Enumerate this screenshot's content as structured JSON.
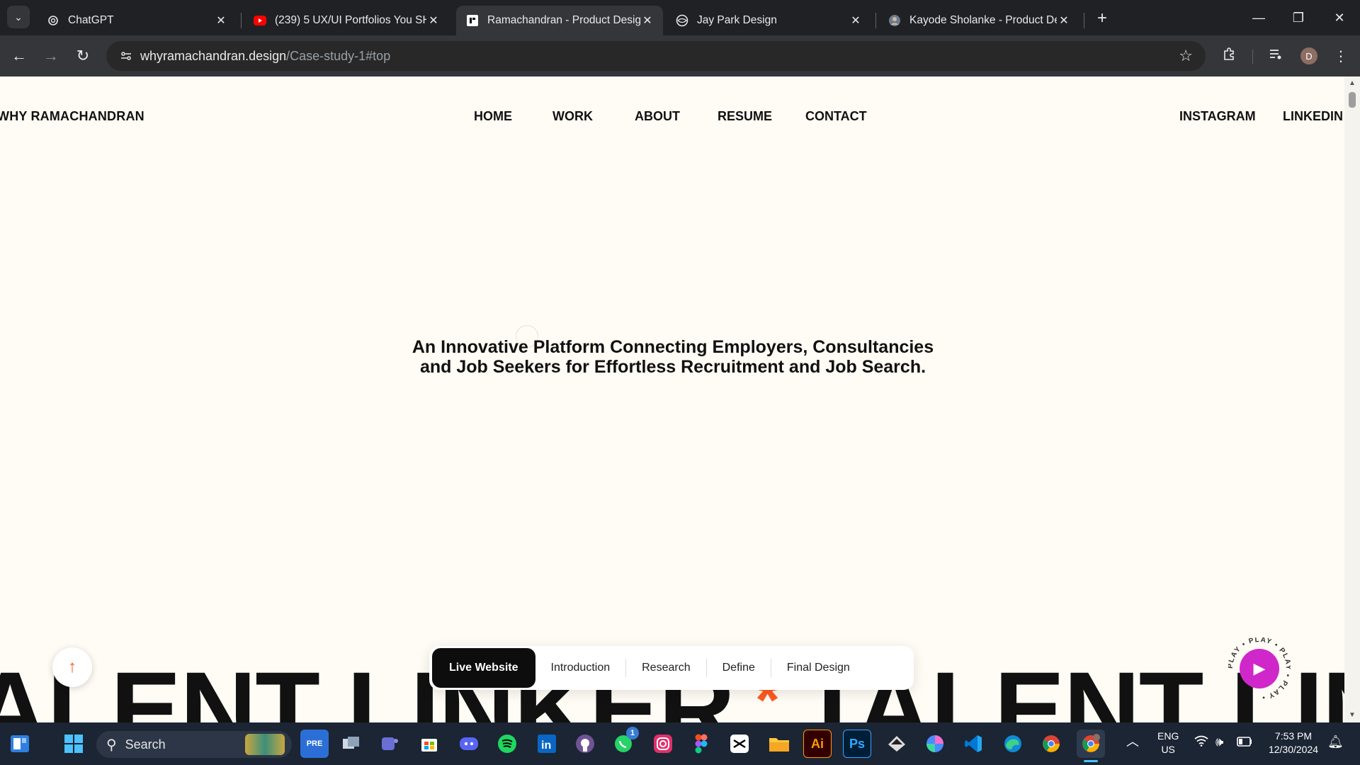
{
  "browser": {
    "tabs": [
      {
        "title": "ChatGPT",
        "active": false
      },
      {
        "title": "(239) 5 UX/UI Portfolios You SH",
        "active": false
      },
      {
        "title": "Ramachandran - Product Desig",
        "active": true
      },
      {
        "title": "Jay Park Design",
        "active": false
      },
      {
        "title": "Kayode Sholanke - Product Des",
        "active": false
      }
    ],
    "url_host": "whyramachandran.design",
    "url_path": "/Case-study-1#top",
    "profile_initial": "D"
  },
  "site": {
    "logo": "WHY RAMACHANDRAN",
    "nav": [
      "HOME",
      "WORK",
      "ABOUT",
      "RESUME",
      "CONTACT"
    ],
    "social": [
      "INSTAGRAM",
      "LINKEDIN"
    ],
    "hero_line1": "An Innovative Platform Connecting Employers, Consultancies",
    "hero_line2": "and Job Seekers for Effortless Recruitment and Job Search.",
    "marquee_a": "ALENT LINKER",
    "marquee_ast": "*",
    "marquee_b": "TALENT LINK",
    "section_nav": [
      "Live Website",
      "Introduction",
      "Research",
      "Define",
      "Final Design"
    ],
    "play_ring": "PLAY • PLAY • PLAY • PLAY •",
    "accent": "#ff5a1f",
    "play_color": "#cf27c9"
  },
  "taskbar": {
    "search_placeholder": "Search",
    "whatsapp_badge": "1",
    "lang_top": "ENG",
    "lang_bottom": "US",
    "time": "7:53 PM",
    "date": "12/30/2024"
  }
}
